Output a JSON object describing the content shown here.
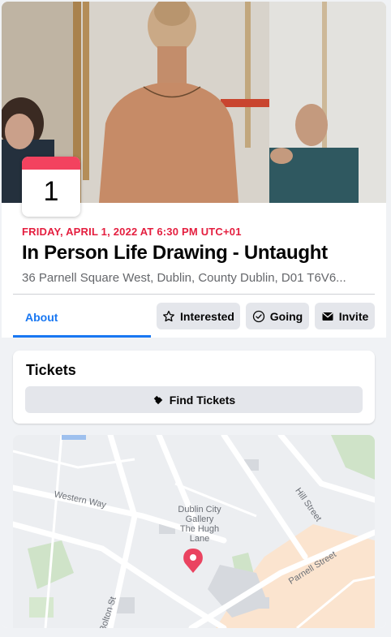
{
  "event": {
    "day": "1",
    "datetime": "FRIDAY, APRIL 1, 2022 AT 6:30 PM UTC+01",
    "title": "In Person Life Drawing - Untaught",
    "address": "36 Parnell Square West, Dublin, County Dublin, D01 T6V6..."
  },
  "tabs": {
    "about": "About"
  },
  "actions": {
    "interested": "Interested",
    "going": "Going",
    "invite": "Invite"
  },
  "tickets": {
    "title": "Tickets",
    "find_label": "Find Tickets"
  },
  "map": {
    "streets": {
      "western_way": "Western Way",
      "hill_street": "Hill Street",
      "parnell_street": "Parnell Street",
      "bolton_st": "Bolton St"
    },
    "poi": {
      "line1": "Dublin City",
      "line2": "Gallery",
      "line3": "The Hugh",
      "line4": "Lane"
    }
  },
  "colors": {
    "accent": "#1877f2",
    "date": "#e41e3f",
    "calendar": "#f3425f",
    "pin": "#ea4360"
  }
}
